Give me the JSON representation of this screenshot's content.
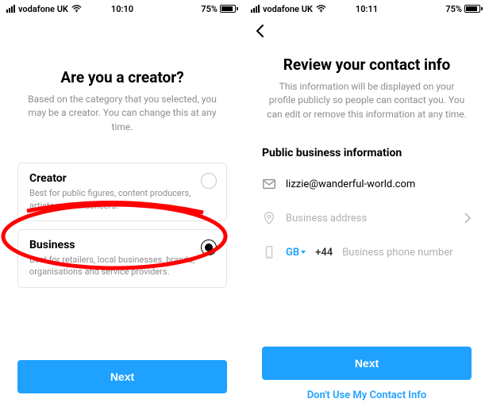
{
  "status": {
    "carrier": "vodafone UK",
    "battery_pct": "75%"
  },
  "screen1": {
    "time": "10:10",
    "title": "Are you a creator?",
    "subtitle": "Based on the category that you selected, you may be a creator. You can change this at any time.",
    "creator": {
      "title": "Creator",
      "desc": "Best for public figures, content producers, artists and influencers."
    },
    "business": {
      "title": "Business",
      "desc": "Best for retailers, local businesses, brands, organisations and service providers."
    },
    "next": "Next"
  },
  "screen2": {
    "time": "10:11",
    "title": "Review your contact info",
    "subtitle": "This information will be displayed on your profile publicly so people can contact you. You can edit or remove this information at any time.",
    "section": "Public business information",
    "email": "lizzie@wanderful-world.com",
    "address_placeholder": "Business address",
    "country": "GB",
    "dial": "+44",
    "phone_placeholder": "Business phone number",
    "next": "Next",
    "dont_use": "Don't Use My Contact Info"
  }
}
